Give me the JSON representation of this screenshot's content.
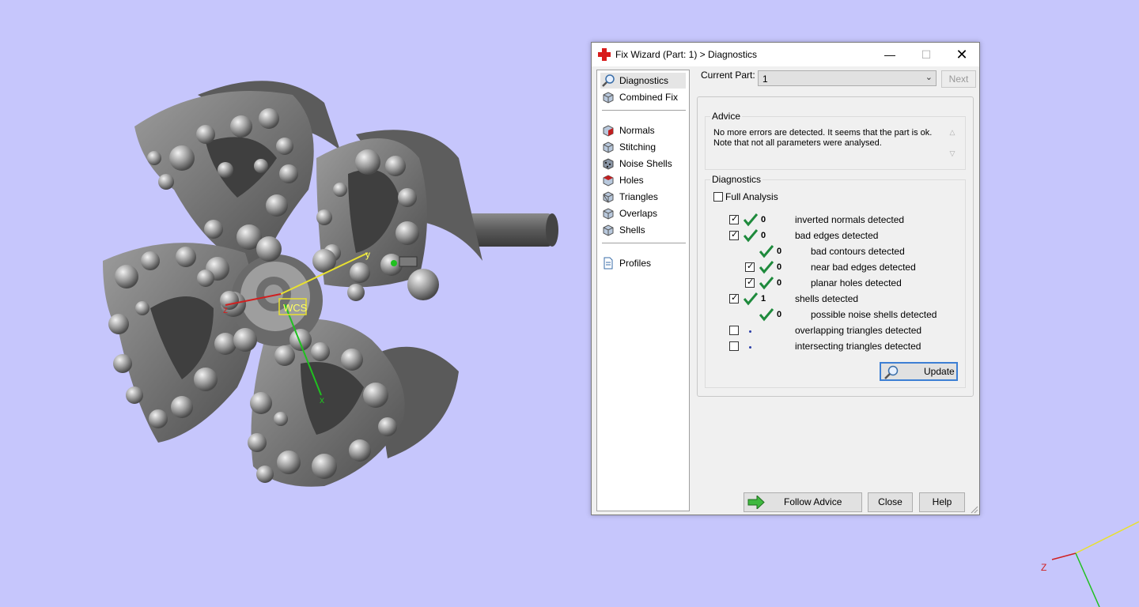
{
  "viewport": {
    "wcs_label": "WCS",
    "axis_x": "x",
    "axis_y": "y",
    "axis_z": "z",
    "corner_axis_z": "Z",
    "background": "#c6c6fc"
  },
  "dialog": {
    "title": "Fix Wizard (Part: 1) > Diagnostics",
    "nav_items": [
      {
        "label": "Diagnostics",
        "icon": "magnifier-icon"
      },
      {
        "label": "Combined Fix",
        "icon": "cube-icon"
      },
      {
        "label": "Normals",
        "icon": "normals-cube-icon"
      },
      {
        "label": "Stitching",
        "icon": "stitching-cube-icon"
      },
      {
        "label": "Noise Shells",
        "icon": "noise-shells-icon"
      },
      {
        "label": "Holes",
        "icon": "holes-cube-icon"
      },
      {
        "label": "Triangles",
        "icon": "triangles-cube-icon"
      },
      {
        "label": "Overlaps",
        "icon": "overlaps-cube-icon"
      },
      {
        "label": "Shells",
        "icon": "shells-cube-icon"
      },
      {
        "label": "Profiles",
        "icon": "document-icon"
      }
    ],
    "current_part_label": "Current Part:",
    "current_part_value": "1",
    "next_label": "Next",
    "advice_title": "Advice",
    "advice_line1": "No more errors are detected. It seems that the part is ok.",
    "advice_line2": "Note that not all parameters were analysed.",
    "diagnostics_title": "Diagnostics",
    "full_analysis_label": "Full Analysis",
    "rows": [
      {
        "count": "0",
        "label": "inverted normals detected"
      },
      {
        "count": "0",
        "label": "bad edges detected"
      },
      {
        "count": "0",
        "label": "bad contours detected"
      },
      {
        "count": "0",
        "label": "near bad edges detected"
      },
      {
        "count": "0",
        "label": "planar holes detected"
      },
      {
        "count": "1",
        "label": "shells detected"
      },
      {
        "count": "0",
        "label": "possible noise shells detected"
      },
      {
        "count": "",
        "label": "overlapping triangles detected"
      },
      {
        "count": "",
        "label": "intersecting triangles detected"
      }
    ],
    "update_label": "Update",
    "follow_advice_label": "Follow Advice",
    "close_label": "Close",
    "help_label": "Help",
    "accent_color": "#3c7fd4",
    "ok_color": "#1e8a3c"
  }
}
